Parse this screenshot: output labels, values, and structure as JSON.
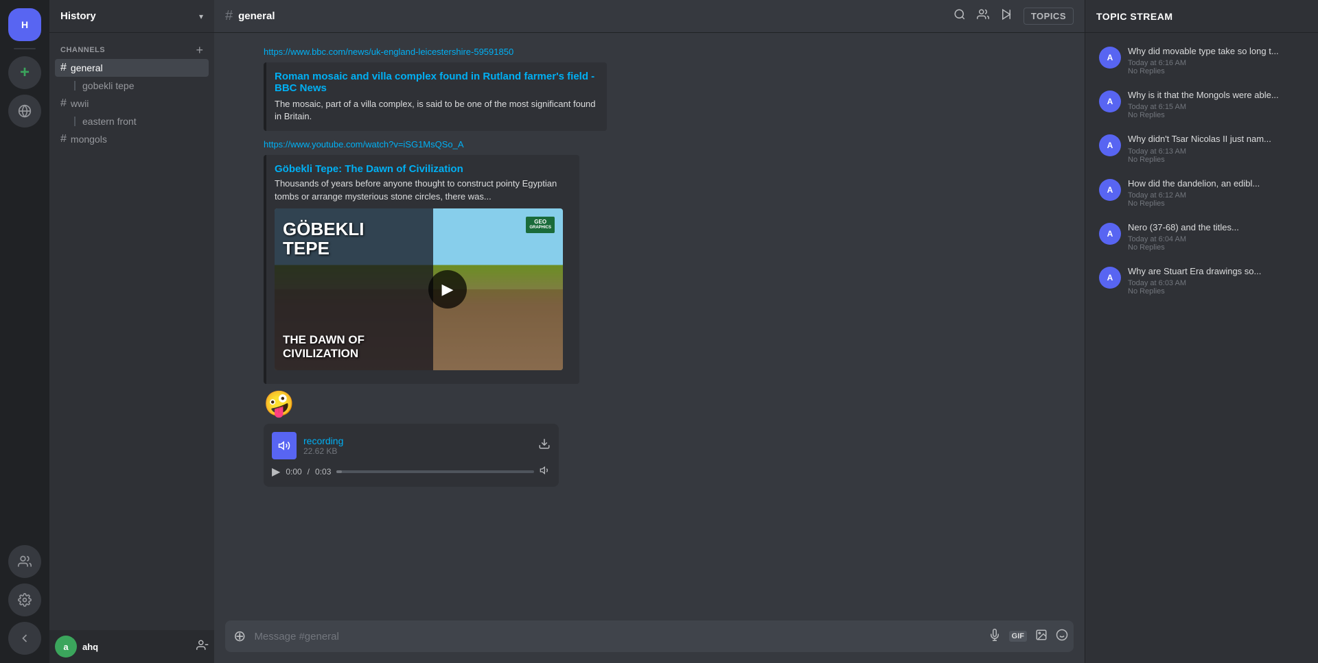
{
  "iconBar": {
    "serverInitial": "H",
    "addServer": "+",
    "exploreIcon": "🌐",
    "friendsIcon": "👥",
    "settingsIcon": "⚙"
  },
  "sidebar": {
    "title": "History",
    "channels": {
      "sectionLabel": "CHANNELS",
      "addIcon": "+",
      "items": [
        {
          "id": "general",
          "name": "general",
          "active": true,
          "thread": null
        },
        {
          "id": "gobekli-tepe",
          "name": "gobekli tepe",
          "active": false,
          "isThread": true
        },
        {
          "id": "wwii",
          "name": "wwii",
          "active": false,
          "thread": null
        },
        {
          "id": "eastern-front",
          "name": "eastern front",
          "active": false,
          "isThread": true
        },
        {
          "id": "mongols",
          "name": "mongols",
          "active": false,
          "thread": null
        }
      ]
    },
    "footer": {
      "username": "ahq",
      "avatarColor": "#3ba55c",
      "avatarInitial": "a"
    }
  },
  "mainHeader": {
    "channelName": "general",
    "topicsButtonLabel": "TOPICS"
  },
  "messages": {
    "linkUrl1": "https://www.bbc.com/news/uk-england-leicestershire-59591850",
    "linkTitle1": "Roman mosaic and villa complex found in Rutland farmer's field - BBC News",
    "linkDesc1": "The mosaic, part of a villa complex, is said to be one of the most significant found in Britain.",
    "youtubeUrl": "https://www.youtube.com/watch?v=iSG1MsQSo_A",
    "videoTitle": "Göbekli Tepe: The Dawn of Civilization",
    "videoDesc": "Thousands of years before anyone thought to construct pointy Egyptian tombs or arrange mysterious stone circles, there was...",
    "videoTitleLine1": "GÖBEKLI",
    "videoTitleLine2": "TEPE",
    "videoSubLine1": "THE DAWN OF",
    "videoSubLine2": "CIVILIZATION",
    "geoBadgeLine1": "GEO",
    "geoBadgeLine2": "GRAPHICS",
    "emoji": "🤪",
    "audioFilename": "recording",
    "audioSize": "22.62 KB",
    "audioCurrentTime": "0:00",
    "audioDuration": "0:03"
  },
  "chatInput": {
    "placeholder": "Message #general"
  },
  "topicPanel": {
    "title": "TOPIC STREAM",
    "topics": [
      {
        "id": 1,
        "question": "Why did movable type take so long t...",
        "time": "Today at 6:16 AM",
        "replies": "No Replies"
      },
      {
        "id": 2,
        "question": "Why is it that the Mongols were able...",
        "time": "Today at 6:15 AM",
        "replies": "No Replies"
      },
      {
        "id": 3,
        "question": "Why didn't Tsar Nicolas II just nam...",
        "time": "Today at 6:13 AM",
        "replies": "No Replies"
      },
      {
        "id": 4,
        "question": "How did the dandelion, an edibl...",
        "time": "Today at 6:12 AM",
        "replies": "No Replies"
      },
      {
        "id": 5,
        "question": "Nero (37-68) and the titles...",
        "time": "Today at 6:04 AM",
        "replies": "No Replies"
      },
      {
        "id": 6,
        "question": "Why are Stuart Era drawings so...",
        "time": "Today at 6:03 AM",
        "replies": "No Replies"
      }
    ]
  }
}
